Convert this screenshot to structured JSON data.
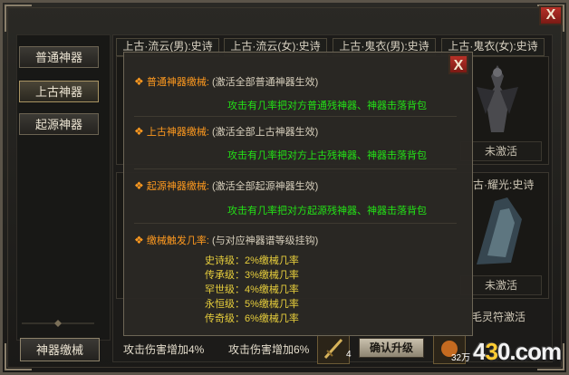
{
  "window": {
    "close_label": "X"
  },
  "sidebar": {
    "items": [
      {
        "label": "普通神器"
      },
      {
        "label": "上古神器"
      },
      {
        "label": "起源神器"
      }
    ],
    "bottom_button": "神器缴械"
  },
  "tabs": [
    {
      "label": "上古·流云(男):史诗"
    },
    {
      "label": "上古·流云(女):史诗"
    },
    {
      "label": "上古·鬼衣(男):史诗"
    },
    {
      "label": "上古·鬼衣(女):史诗"
    }
  ],
  "cards": {
    "right_title": "古·耀光:史诗",
    "status_top": "未激活",
    "status_bottom": "未激活",
    "rune_text": "毛灵符激活"
  },
  "bottom": {
    "bonus_1": "攻击伤害增加4%",
    "bonus_2": "攻击伤害增加6%",
    "slot_count": "4",
    "upgrade_label": "确认升级",
    "cost_fragment": "32万"
  },
  "logo": {
    "prefix": "4",
    "accent": "3",
    "suffix": "0.com"
  },
  "popup": {
    "close_label": "X",
    "sections": [
      {
        "title": "普通神器缴械:",
        "note": "(激活全部普通神器生效)",
        "effect": "攻击有几率把对方普通残神器、神器击落背包"
      },
      {
        "title": "上古神器缴械:",
        "note": "(激活全部上古神器生效)",
        "effect": "攻击有几率把对方上古残神器、神器击落背包"
      },
      {
        "title": "起源神器缴械:",
        "note": "(激活全部起源神器生效)",
        "effect": "攻击有几率把对方起源残神器、神器击落背包"
      }
    ],
    "trigger": {
      "title": "缴械触发几率:",
      "note": "(与对应神器谱等级挂钩)",
      "levels": [
        "史诗级：2%缴械几率",
        "传承级：3%缴械几率",
        "罕世级：4%缴械几率",
        "永恒级：5%缴械几率",
        "传奇级：6%缴械几率"
      ]
    }
  }
}
